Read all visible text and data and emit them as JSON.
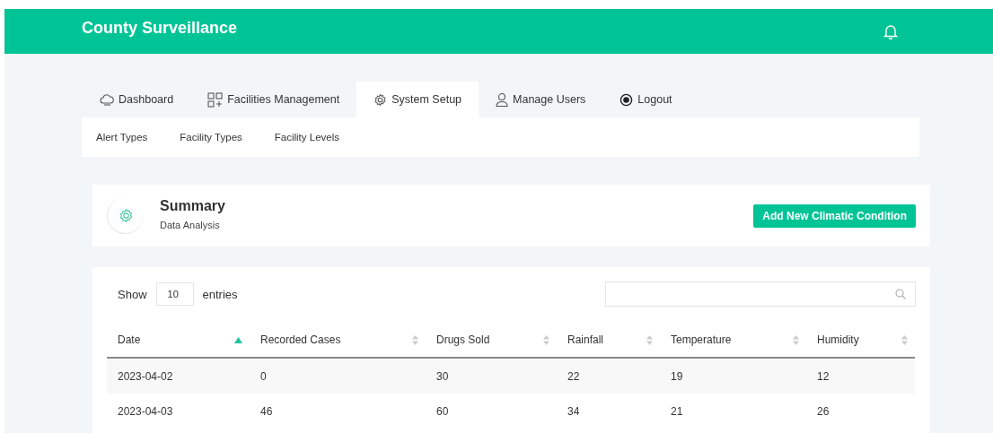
{
  "header": {
    "title": "County Surveillance"
  },
  "tabs": [
    {
      "label": "Dashboard",
      "selected": false
    },
    {
      "label": "Facilities Management",
      "selected": false
    },
    {
      "label": "System Setup",
      "selected": true
    },
    {
      "label": "Manage Users",
      "selected": false
    },
    {
      "label": "Logout",
      "selected": false
    }
  ],
  "subnav": [
    "Alert Types",
    "Facility Types",
    "Facility Levels"
  ],
  "summary": {
    "title": "Summary",
    "subtitle": "Data Analysis",
    "button": "Add New Climatic Condition"
  },
  "table": {
    "show_label": "Show",
    "page_size": "10",
    "entries_label": "entries",
    "columns": [
      {
        "label": "Date",
        "sorted": true
      },
      {
        "label": "Recorded Cases",
        "sorted": false
      },
      {
        "label": "Drugs Sold",
        "sorted": false
      },
      {
        "label": "Rainfall",
        "sorted": false
      },
      {
        "label": "Temperature",
        "sorted": false
      },
      {
        "label": "Humidity",
        "sorted": false
      }
    ],
    "rows": [
      [
        "2023-04-02",
        "0",
        "30",
        "22",
        "19",
        "12"
      ],
      [
        "2023-04-03",
        "46",
        "60",
        "34",
        "21",
        "26"
      ]
    ]
  }
}
